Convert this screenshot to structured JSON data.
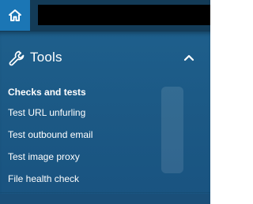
{
  "topbar": {
    "home_icon": "home-icon",
    "search_value": "",
    "colors": {
      "bar": "#133b57",
      "home_button": "#1b76b5",
      "field": "#000000"
    }
  },
  "menu": {
    "section": {
      "title": "Tools",
      "icon": "wrench-icon",
      "expanded": true,
      "toggle_icon": "chevron-up-icon"
    },
    "group_heading": "Checks and tests",
    "items": [
      {
        "label": "Test URL unfurling"
      },
      {
        "label": "Test outbound email"
      },
      {
        "label": "Test image proxy"
      },
      {
        "label": "File health check"
      }
    ],
    "colors": {
      "panel": "#1e5f8c",
      "text": "#ffffff"
    }
  }
}
